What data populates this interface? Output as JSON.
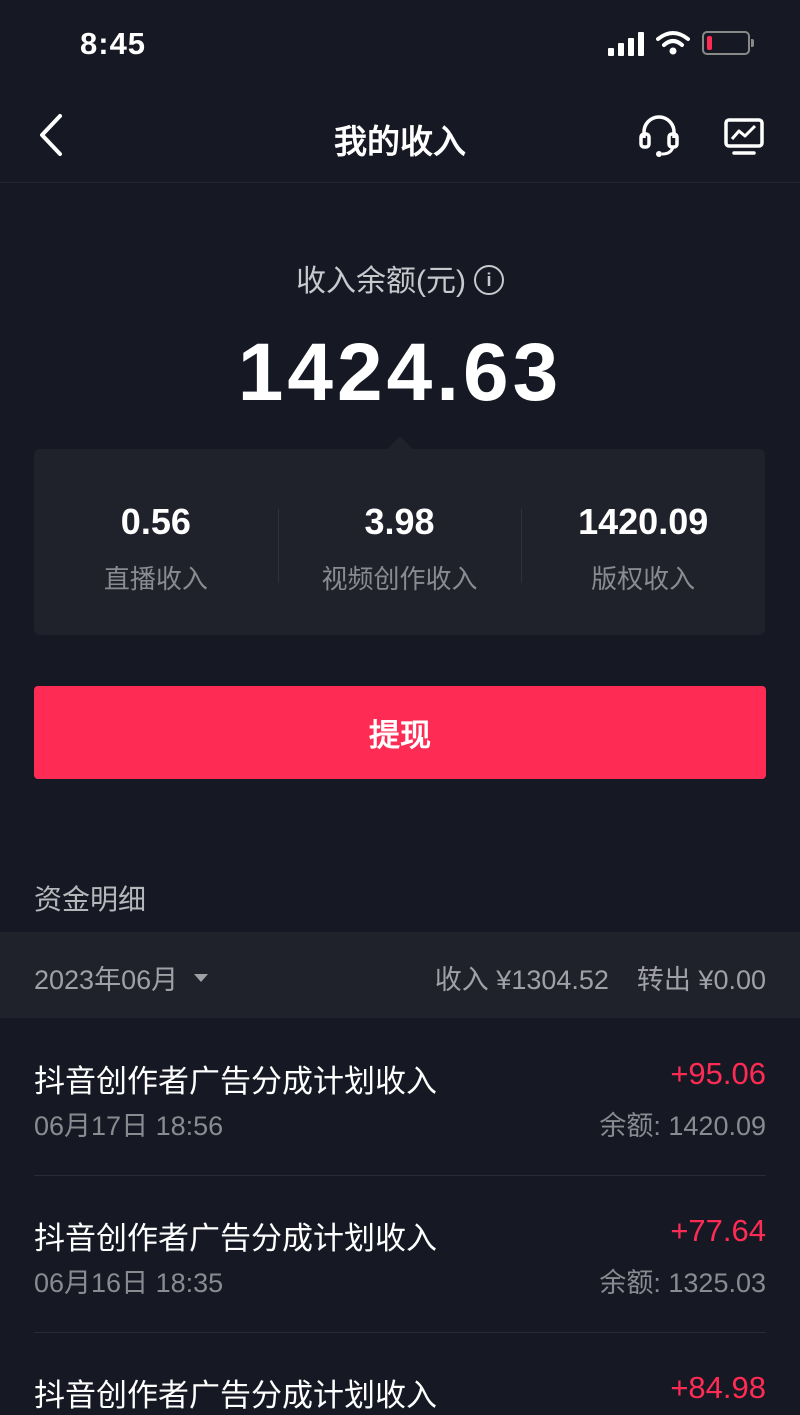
{
  "status_bar": {
    "time": "8:45",
    "icons": [
      "signal-icon",
      "wifi-icon",
      "battery-low-icon"
    ]
  },
  "nav": {
    "title": "我的收入",
    "back_icon": "chevron-left-icon",
    "service_icon": "headset-icon",
    "chart_icon": "chart-icon"
  },
  "balance": {
    "label": "收入余额(元)",
    "amount": "1424.63",
    "info_icon": "info-icon"
  },
  "breakdown": [
    {
      "value": "0.56",
      "label": "直播收入"
    },
    {
      "value": "3.98",
      "label": "视频创作收入"
    },
    {
      "value": "1420.09",
      "label": "版权收入"
    }
  ],
  "withdraw_label": "提现",
  "details": {
    "title": "资金明细",
    "month": "2023年06月",
    "income_summary": "收入 ¥1304.52",
    "outflow_summary": "转出 ¥0.00"
  },
  "transactions": [
    {
      "name": "抖音创作者广告分成计划收入",
      "date": "06月17日 18:56",
      "amount": "+95.06",
      "balance": "余额: 1420.09"
    },
    {
      "name": "抖音创作者广告分成计划收入",
      "date": "06月16日 18:35",
      "amount": "+77.64",
      "balance": "余额: 1325.03"
    },
    {
      "name": "抖音创作者广告分成计划收入",
      "date": "",
      "amount": "+84.98",
      "balance": ""
    }
  ],
  "colors": {
    "background": "#161823",
    "accent": "#fe2c55",
    "card": "#20222b"
  }
}
